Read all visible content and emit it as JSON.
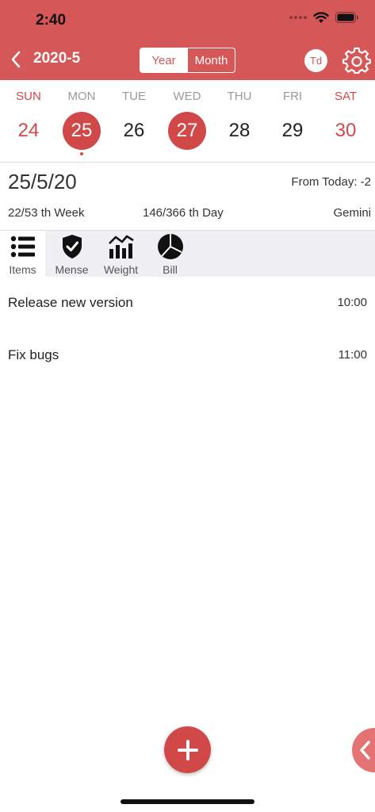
{
  "status_bar": {
    "time": "2:40"
  },
  "nav": {
    "back_icon": "chevron-left-icon",
    "title": "2020-5",
    "segments": [
      "Year",
      "Month"
    ],
    "today_button": "Td",
    "settings_icon": "gear-icon"
  },
  "week": {
    "days": [
      {
        "label": "SUN",
        "num": "24",
        "weekend": true,
        "circled": false
      },
      {
        "label": "MON",
        "num": "25",
        "weekend": false,
        "circled": true,
        "today": true
      },
      {
        "label": "TUE",
        "num": "26",
        "weekend": false,
        "circled": false
      },
      {
        "label": "WED",
        "num": "27",
        "weekend": false,
        "circled": true
      },
      {
        "label": "THU",
        "num": "28",
        "weekend": false,
        "circled": false
      },
      {
        "label": "FRI",
        "num": "29",
        "weekend": false,
        "circled": false
      },
      {
        "label": "SAT",
        "num": "30",
        "weekend": true,
        "circled": false
      }
    ]
  },
  "detail": {
    "date": "25/5/20",
    "from_today": "From Today: -2",
    "week_info": "22/53 th Week",
    "day_info": "146/366 th Day",
    "zodiac": "Gemini"
  },
  "tabs": [
    {
      "label": "Items",
      "icon": "list-icon"
    },
    {
      "label": "Mense",
      "icon": "shield-check-icon"
    },
    {
      "label": "Weight",
      "icon": "chart-icon"
    },
    {
      "label": "Bill",
      "icon": "pie-chart-icon"
    }
  ],
  "items": [
    {
      "title": "Release new version",
      "time": "10:00"
    },
    {
      "title": "Fix bugs",
      "time": "11:00"
    }
  ],
  "fab_icon": "plus-icon",
  "colors": {
    "accent": "#d65757",
    "weekend": "#d04848"
  }
}
